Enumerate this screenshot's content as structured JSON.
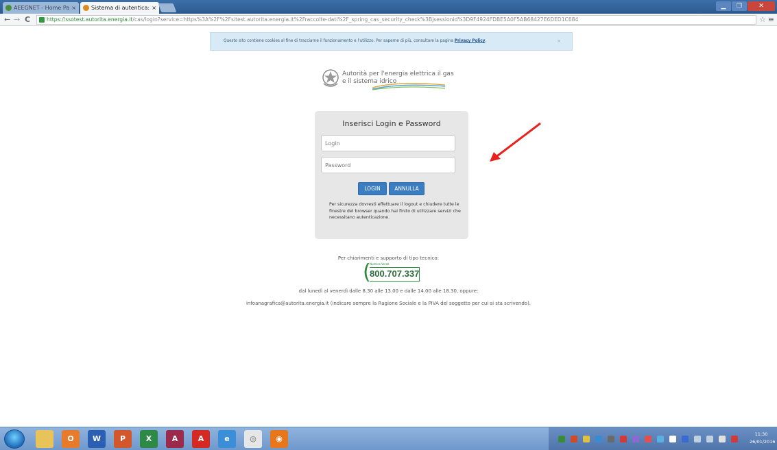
{
  "browser": {
    "tabs": [
      {
        "title": "AEEGNET - Home Pa",
        "close": "×",
        "active": false
      },
      {
        "title": "Sistema di autentica:",
        "close": "×",
        "active": true
      }
    ],
    "url_scheme": "https://",
    "url_host": "ssotest.autorita.energia.it",
    "url_path": "/cas/login?service=https%3A%2F%2Fsitest.autorita.energia.it%2Fraccolte-dati%2F_spring_cas_security_check%3Bjsessionid%3D9F4924FDBE5A0F5AB68427E6DED1C684"
  },
  "cookie_banner": {
    "text": "Questo sito contiene cookies al fine di tracciarne il funzionamento e l'utilizzo. Per saperne di più, consultare la pagina",
    "link": "Privacy Policy",
    "close": "×"
  },
  "logo": {
    "line1": "Autorità per l'energia elettrica il gas",
    "line2": "e il sistema idrico"
  },
  "login": {
    "title": "Inserisci Login e Password",
    "login_placeholder": "Login",
    "password_placeholder": "Password",
    "login_button": "LOGIN",
    "cancel_button": "ANNULLA",
    "note": "Per sicurezza dovresti effettuare il logout e chiudere tutte le finestre del browser quando hai finito di utilizzare servizi che necessitano autenticazione."
  },
  "support": {
    "intro": "Per chiarimenti e supporto di tipo tecnico:",
    "phone_caption": "Numero Verde",
    "phone_number": "800.707.337",
    "hours": "dal lunedì al venerdì dalle 8.30 alle 13.00 e dalle 14.00 alle 18.30, oppure:",
    "email": "infoanagrafica@autorita.energia.it (indicare sempre la Ragione Sociale e la PIVA del soggetto per cui si sta scrivendo)."
  },
  "taskbar": {
    "clock_time": "11:30",
    "clock_date": "26/01/2016"
  },
  "colors": {
    "primary_button": "#3a7ec1",
    "annotation_arrow": "#e8231f",
    "panel_bg": "#e7e7e7"
  }
}
